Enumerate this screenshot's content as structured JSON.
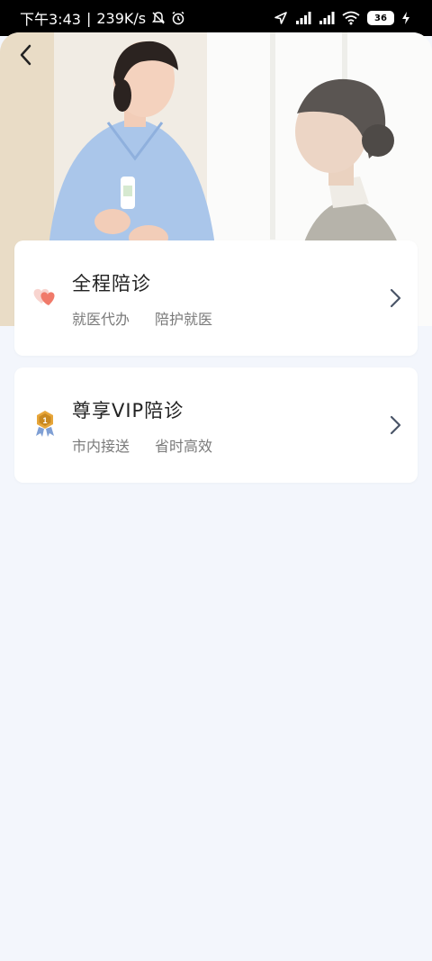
{
  "status_bar": {
    "time": "下午3:43",
    "separator": "|",
    "net_speed": "239K/s",
    "battery": "36"
  },
  "header": {
    "back_icon": "chevron-left-icon"
  },
  "services": [
    {
      "icon": "heart-icon",
      "title": "全程陪诊",
      "tags": [
        "就医代办",
        "陪护就医"
      ]
    },
    {
      "icon": "medal-icon",
      "title": "尊享VIP陪诊",
      "tags": [
        "市内接送",
        "省时高效"
      ]
    }
  ],
  "colors": {
    "page_bg": "#f3f6fc",
    "card_bg": "#ffffff",
    "heart_accent": "#f07a6a",
    "medal_gold": "#e7a63a",
    "arrow": "#4a5568"
  }
}
